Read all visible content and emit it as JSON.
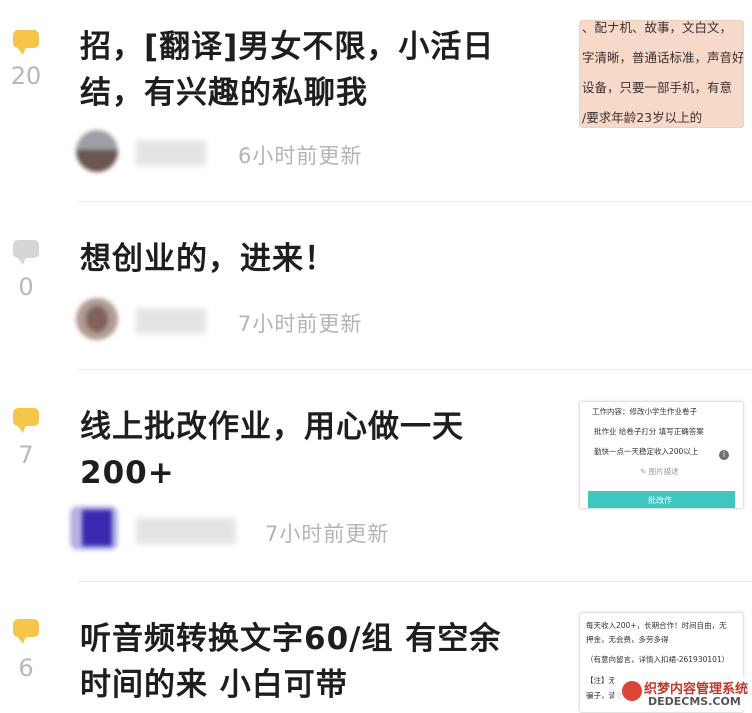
{
  "posts": [
    {
      "count": "20",
      "bubble_color": "yellow",
      "title_line1": "招，[翻译]男女不限，小活日",
      "title_line2": "结，有兴趣的私聊我",
      "time": "6小时前更新",
      "thumb_lines": [
        "、配ナ机、故事，文白文，",
        "字清晰，普通话标准，声音好",
        "设备，只要一部手机，有意",
        "/要求年龄23岁以上的"
      ]
    },
    {
      "count": "0",
      "bubble_color": "grey",
      "title_line1": "想创业的，进来！",
      "time": "7小时前更新"
    },
    {
      "count": "7",
      "bubble_color": "yellow",
      "title_line1": "线上批改作业，用心做一天",
      "title_line2": "200+",
      "time": "7小时前更新",
      "thumb_lines": [
        "工作内容：修改小学生作业卷子",
        "批作业 给卷子打分 填写正确答案",
        "勤快一点一天稳定收入200以上",
        "✎ 图片描述"
      ],
      "thumb_banner": "批改作"
    },
    {
      "count": "6",
      "bubble_color": "yellow",
      "title_line1": "听音频转换文字60/组 有空余",
      "title_line2": "时间的来 小白可带",
      "thumb_lines": [
        "每天收入200+，长期合作！时间自由，无",
        "押金，无会费，多劳多得",
        "（有意向留言，详情入扣裙-261930101）",
        "【注】无",
        "骗子，请勿"
      ]
    }
  ],
  "watermark": {
    "line1": "织梦内容管理系统",
    "line2": "DEDECMS.COM"
  }
}
